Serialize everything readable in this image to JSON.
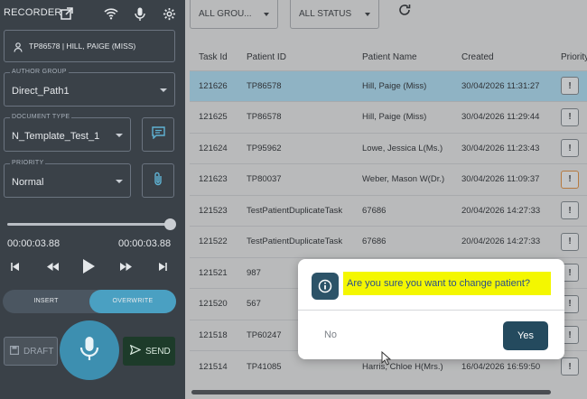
{
  "recorder": {
    "title": "RECORDER",
    "icons": [
      "external-link-icon",
      "wifi-icon",
      "mic-small-icon",
      "gear-icon"
    ],
    "patient": "TP86578 | HILL, PAIGE (MISS)",
    "author_group": {
      "label": "AUTHOR GROUP",
      "value": "Direct_Path1"
    },
    "document_type": {
      "label": "DOCUMENT TYPE",
      "value": "N_Template_Test_1"
    },
    "priority": {
      "label": "PRIORITY",
      "value": "Normal"
    },
    "progress": 1.0,
    "time_elapsed": "00:00:03.88",
    "time_total": "00:00:03.88",
    "modes": {
      "insert": "INSERT",
      "overwrite": "OVERWRITE",
      "active": "overwrite"
    },
    "draft_label": "DRAFT",
    "send_label": "SEND"
  },
  "filters": {
    "group": "ALL GROU...",
    "status": "ALL STATUS"
  },
  "table": {
    "headers": [
      "Task Id",
      "Patient ID",
      "Patient Name",
      "Created",
      "Priority"
    ],
    "rows": [
      {
        "task_id": "121626",
        "patient_id": "TP86578",
        "patient_name": "Hill, Paige (Miss)",
        "created": "30/04/2026 11:31:27",
        "selected": true,
        "high": false
      },
      {
        "task_id": "121625",
        "patient_id": "TP86578",
        "patient_name": "Hill, Paige (Miss)",
        "created": "30/04/2026 11:29:44",
        "selected": false,
        "high": false
      },
      {
        "task_id": "121624",
        "patient_id": "TP95962",
        "patient_name": "Lowe, Jessica L(Ms.)",
        "created": "30/04/2026 11:23:43",
        "selected": false,
        "high": false
      },
      {
        "task_id": "121623",
        "patient_id": "TP80037",
        "patient_name": "Weber, Mason W(Dr.)",
        "created": "30/04/2026 11:09:37",
        "selected": false,
        "high": true
      },
      {
        "task_id": "121523",
        "patient_id": "TestPatientDuplicateTask",
        "patient_name": "67686",
        "created": "20/04/2026 14:27:33",
        "selected": false,
        "high": false
      },
      {
        "task_id": "121522",
        "patient_id": "TestPatientDuplicateTask",
        "patient_name": "67686",
        "created": "20/04/2026 14:27:33",
        "selected": false,
        "high": false
      },
      {
        "task_id": "121521",
        "patient_id": "987",
        "patient_name": "",
        "created": "",
        "selected": false,
        "high": false
      },
      {
        "task_id": "121520",
        "patient_id": "567",
        "patient_name": "",
        "created": "",
        "selected": false,
        "high": false
      },
      {
        "task_id": "121518",
        "patient_id": "TP60247",
        "patient_name": "",
        "created": "",
        "selected": false,
        "high": false
      },
      {
        "task_id": "121514",
        "patient_id": "TP41085",
        "patient_name": "Harris, Chloe H(Mrs.)",
        "created": "16/04/2026 16:59:50",
        "selected": false,
        "high": false
      }
    ]
  },
  "dialog": {
    "message": "Are you sure you want to change patient?",
    "no_label": "No",
    "yes_label": "Yes"
  },
  "colors": {
    "panel": "#3a4148",
    "accent": "#4aa0c2",
    "selected_row": "#8fb3c4",
    "highlight": "#f4f700",
    "yes_button": "#244a5e"
  }
}
